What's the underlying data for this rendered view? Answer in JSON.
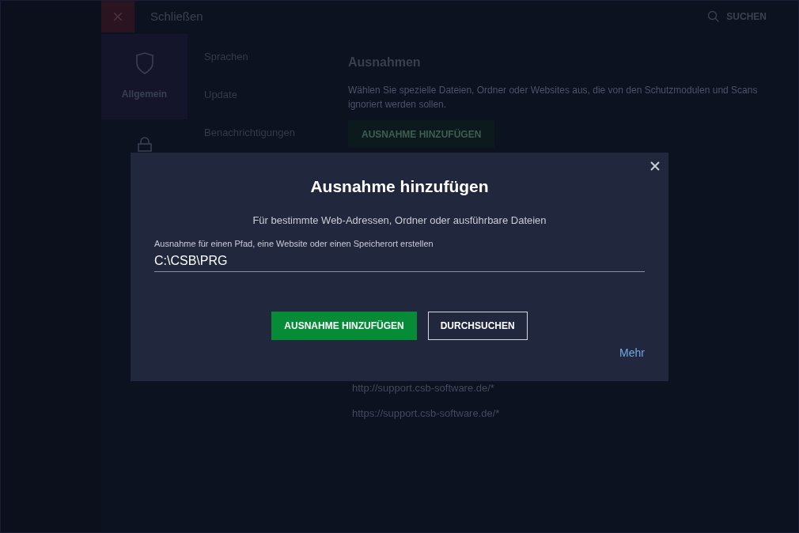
{
  "top_bar": {
    "close_label": "Schließen",
    "search_label": "SUCHEN"
  },
  "categories": [
    {
      "kind": "shield",
      "label": "Allgemein",
      "selected": true
    },
    {
      "kind": "lock",
      "selected": false
    }
  ],
  "submenu": [
    "Sprachen",
    "Update",
    "Benachrichtigungen"
  ],
  "section": {
    "title": "Ausnahmen",
    "description": "Wählen Sie spezielle Dateien, Ordner oder Websites aus, die von den Schutzmodulen und Scans ignoriert werden sollen.",
    "add_button": "AUSNAHME HINZUFÜGEN",
    "entries": [
      "http://support.csb-software.de/*",
      "https://support.csb-software.de/*"
    ]
  },
  "dialog": {
    "title": "Ausnahme hinzufügen",
    "subtitle": "Für bestimmte Web-Adressen, Ordner oder ausführbare Dateien",
    "field": {
      "label": "Ausnahme für einen Pfad, eine Website oder einen Speicherort erstellen",
      "value": "C:\\CSB\\PRG"
    },
    "buttons": [
      {
        "kind": "primary",
        "label": "AUSNAHME HINZUFÜGEN"
      },
      {
        "kind": "secondary",
        "label": "DURCHSUCHEN"
      }
    ],
    "more_link": "Mehr"
  }
}
